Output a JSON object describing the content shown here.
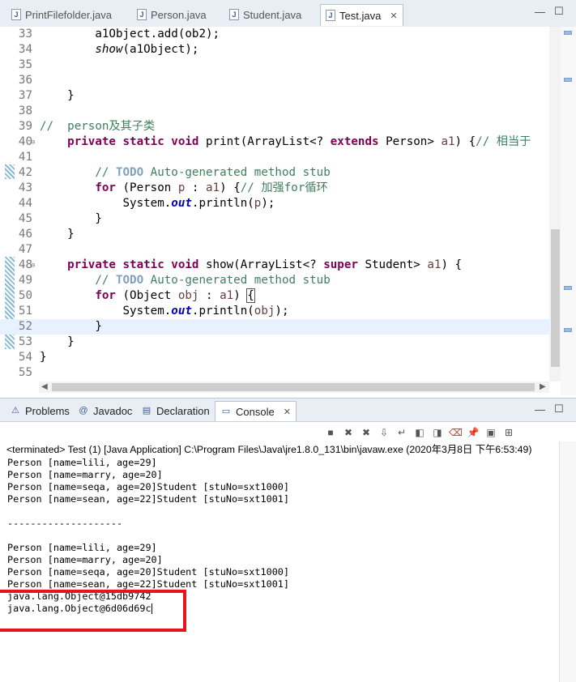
{
  "editor_tabs": [
    {
      "label": "PrintFilefolder.java",
      "active": false
    },
    {
      "label": "Person.java",
      "active": false
    },
    {
      "label": "Student.java",
      "active": false
    },
    {
      "label": "Test.java",
      "active": true
    }
  ],
  "tab_close_glyph": "✕",
  "window_buttons": {
    "minimize": "—",
    "maximize": "☐"
  },
  "code_lines": [
    {
      "n": "33",
      "html": "        a1Object.add(ob2);"
    },
    {
      "n": "34",
      "html": "        <span class='italic'>show</span>(a1Object);"
    },
    {
      "n": "35",
      "html": ""
    },
    {
      "n": "36",
      "html": ""
    },
    {
      "n": "37",
      "html": "    }"
    },
    {
      "n": "38",
      "html": ""
    },
    {
      "n": "39",
      "html": "<span class='cm'>//  person及其子类</span>"
    },
    {
      "n": "40",
      "html": "    <span class='kw'>private static void</span> print(ArrayList&lt;? <span class='kw'>extends</span> Person&gt; <span class='var'>a1</span>) {<span class='cm'>// 相当于</span>"
    },
    {
      "n": "41",
      "html": ""
    },
    {
      "n": "42",
      "html": "        <span class='cm'>// </span><span class='todo'>TODO</span><span class='cm'> Auto-generated method stub</span>"
    },
    {
      "n": "43",
      "html": "        <span class='kw'>for</span> (Person <span class='var'>p</span> : <span class='var'>a1</span>) {<span class='cm'>// 加强for循环</span>"
    },
    {
      "n": "44",
      "html": "            System.<span class='field'>out</span>.println(<span class='var'>p</span>);"
    },
    {
      "n": "45",
      "html": "        }"
    },
    {
      "n": "46",
      "html": "    }"
    },
    {
      "n": "47",
      "html": ""
    },
    {
      "n": "48",
      "html": "    <span class='kw'>private static void</span> show(ArrayList&lt;? <span class='kw'>super</span> Student&gt; <span class='var'>a1</span>) {"
    },
    {
      "n": "49",
      "html": "        <span class='cm'>// </span><span class='todo'>TODO</span><span class='cm'> Auto-generated method stub</span>"
    },
    {
      "n": "50",
      "html": "        <span class='kw'>for</span> (Object <span class='var'>obj</span> : <span class='var'>a1</span>) <span style='outline:1px solid #555'>{</span>"
    },
    {
      "n": "51",
      "html": "            System.<span class='field'>out</span>.println(<span class='var'>obj</span>);"
    },
    {
      "n": "52",
      "html": "        }"
    },
    {
      "n": "53",
      "html": "    }"
    },
    {
      "n": "54",
      "html": "}"
    },
    {
      "n": "55",
      "html": ""
    }
  ],
  "panel_tabs": [
    {
      "label": "Problems",
      "icon": "problems-icon",
      "glyph": "⚠",
      "active": false
    },
    {
      "label": "Javadoc",
      "icon": "javadoc-icon",
      "glyph": "@",
      "active": false
    },
    {
      "label": "Declaration",
      "icon": "declaration-icon",
      "glyph": "▤",
      "active": false
    },
    {
      "label": "Console",
      "icon": "console-icon",
      "glyph": "▭",
      "active": true
    }
  ],
  "console_toolbar": [
    {
      "name": "terminate-icon",
      "glyph": "■"
    },
    {
      "name": "remove-launch-icon",
      "glyph": "✖"
    },
    {
      "name": "remove-all-terminated-icon",
      "glyph": "✖"
    },
    {
      "name": "scroll-lock-icon",
      "glyph": "⇩"
    },
    {
      "name": "word-wrap-icon",
      "glyph": "↵"
    },
    {
      "name": "show-on-stdout-icon",
      "glyph": "◧"
    },
    {
      "name": "show-on-stderr-icon",
      "glyph": "◨"
    },
    {
      "name": "clear-console-icon",
      "glyph": "⌫"
    },
    {
      "name": "pin-console-icon",
      "glyph": "📌"
    },
    {
      "name": "display-selected-console-icon",
      "glyph": "▣"
    },
    {
      "name": "open-console-icon",
      "glyph": "⊞"
    }
  ],
  "terminated_text": "<terminated> Test (1) [Java Application] C:\\Program Files\\Java\\jre1.8.0_131\\bin\\javaw.exe (2020年3月8日 下午6:53:49)",
  "console_lines": [
    "Person [name=lili, age=29]",
    "Person [name=marry, age=20]",
    "Person [name=seqa, age=20]Student [stuNo=sxt1000]",
    "Person [name=sean, age=22]Student [stuNo=sxt1001]",
    "",
    "--------------------",
    "",
    "Person [name=lili, age=29]",
    "Person [name=marry, age=20]",
    "Person [name=seqa, age=20]Student [stuNo=sxt1000]",
    "Person [name=sean, age=22]Student [stuNo=sxt1001]",
    "java.lang.Object@15db9742",
    "java.lang.Object@6d06d69c"
  ],
  "colors": {
    "highlight": "#e8141c",
    "current_line": "#e8f2fe",
    "keyword": "#7f0055",
    "comment": "#3f7f5f"
  }
}
